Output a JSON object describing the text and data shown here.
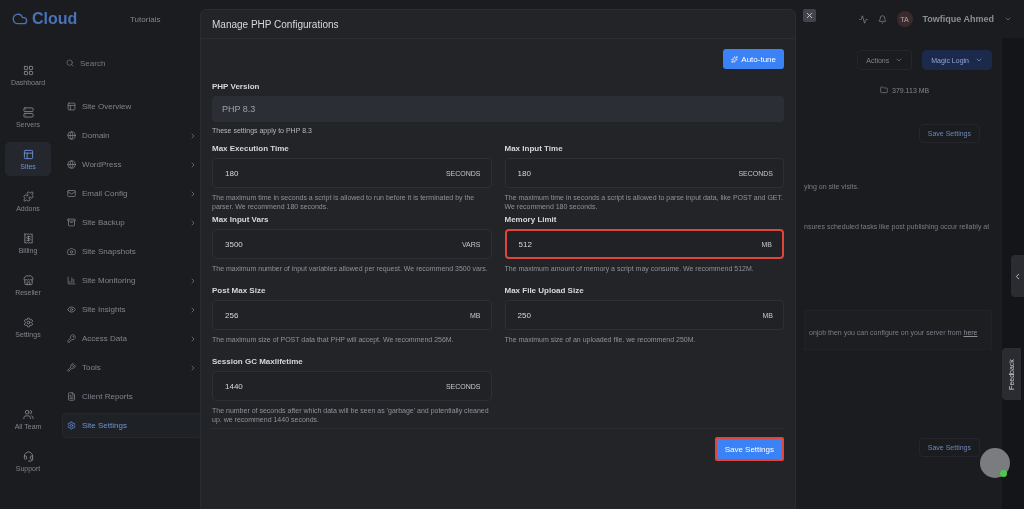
{
  "app": {
    "logo": "Cloud",
    "tutorials": "Tutorials",
    "user_initials": "TA",
    "user_name": "Towfique Ahmed"
  },
  "rail": [
    {
      "label": "Dashboard",
      "selected": false
    },
    {
      "label": "Servers",
      "selected": false
    },
    {
      "label": "Sites",
      "selected": true
    },
    {
      "label": "Addons",
      "selected": false
    },
    {
      "label": "Billing",
      "selected": false
    },
    {
      "label": "Reseller",
      "selected": false
    },
    {
      "label": "Settings",
      "selected": false
    },
    {
      "label": "All Team",
      "selected": false
    },
    {
      "label": "Support",
      "selected": false
    }
  ],
  "subnav": {
    "search_placeholder": "Search",
    "items": [
      {
        "label": "Site Overview",
        "has_submenu": false,
        "selected": false
      },
      {
        "label": "Domain",
        "has_submenu": true,
        "selected": false
      },
      {
        "label": "WordPress",
        "has_submenu": true,
        "selected": false
      },
      {
        "label": "Email Config",
        "has_submenu": true,
        "selected": false
      },
      {
        "label": "Site Backup",
        "has_submenu": true,
        "selected": false
      },
      {
        "label": "Site Snapshots",
        "has_submenu": false,
        "selected": false
      },
      {
        "label": "Site Monitoring",
        "has_submenu": true,
        "selected": false
      },
      {
        "label": "Site Insights",
        "has_submenu": true,
        "selected": false
      },
      {
        "label": "Access Data",
        "has_submenu": true,
        "selected": false
      },
      {
        "label": "Tools",
        "has_submenu": true,
        "selected": false
      },
      {
        "label": "Client Reports",
        "has_submenu": false,
        "selected": false
      },
      {
        "label": "Site Settings",
        "has_submenu": false,
        "selected": true
      }
    ]
  },
  "main": {
    "actions": "Actions",
    "magic_login": "Magic Login",
    "disk_usage": "379.113 MB",
    "save_top": "Save Settings",
    "text_1": "ying on site visits.",
    "text_2": "nsures scheduled tasks like post publishing occur reliably at",
    "notice": "onjob then you can configure on your server from",
    "notice_link": "here",
    "save_bottom": "Save Settings"
  },
  "modal": {
    "title": "Manage PHP Configurations",
    "auto_tune": "Auto-tune",
    "version_label": "PHP Version",
    "version_value": "PHP 8.3",
    "version_note": "These settings apply to PHP 8.3",
    "fields": [
      {
        "label": "Max Execution Time",
        "value": "180",
        "unit": "SECONDS",
        "help": "The maximum time in seconds a script is allowed to run before it is terminated by the parser. We recommend 180 seconds.",
        "highlighted": false
      },
      {
        "label": "Max Input Time",
        "value": "180",
        "unit": "SECONDS",
        "help": "The maximum time in seconds a script is allowed to parse input data, like POST and GET. We recommend 180 seconds.",
        "highlighted": false
      },
      {
        "label": "Max Input Vars",
        "value": "3500",
        "unit": "VARS",
        "help": "The maximum number of input variables allowed per request. We recommend 3500 vars.",
        "highlighted": false
      },
      {
        "label": "Memory Limit",
        "value": "512",
        "unit": "MB",
        "help": "The maximum amount of memory a script may consume. We recommend 512M.",
        "highlighted": true
      },
      {
        "label": "Post Max Size",
        "value": "256",
        "unit": "MB",
        "help": "The maximum size of POST data that PHP will accept. We recommend 256M.",
        "highlighted": false
      },
      {
        "label": "Max File Upload Size",
        "value": "250",
        "unit": "MB",
        "help": "The maximum size of an uploaded file. we recommend 250M.",
        "highlighted": false
      },
      {
        "label": "Session GC Maxlifetime",
        "value": "1440",
        "unit": "SECONDS",
        "help": "The number of seconds after which data will be seen as 'garbage' and potentially cleaned up. we recommend 1440 seconds.",
        "highlighted": false
      }
    ],
    "save": {
      "label": "Save Settings",
      "highlighted": true
    }
  },
  "feedback": "Feedback"
}
